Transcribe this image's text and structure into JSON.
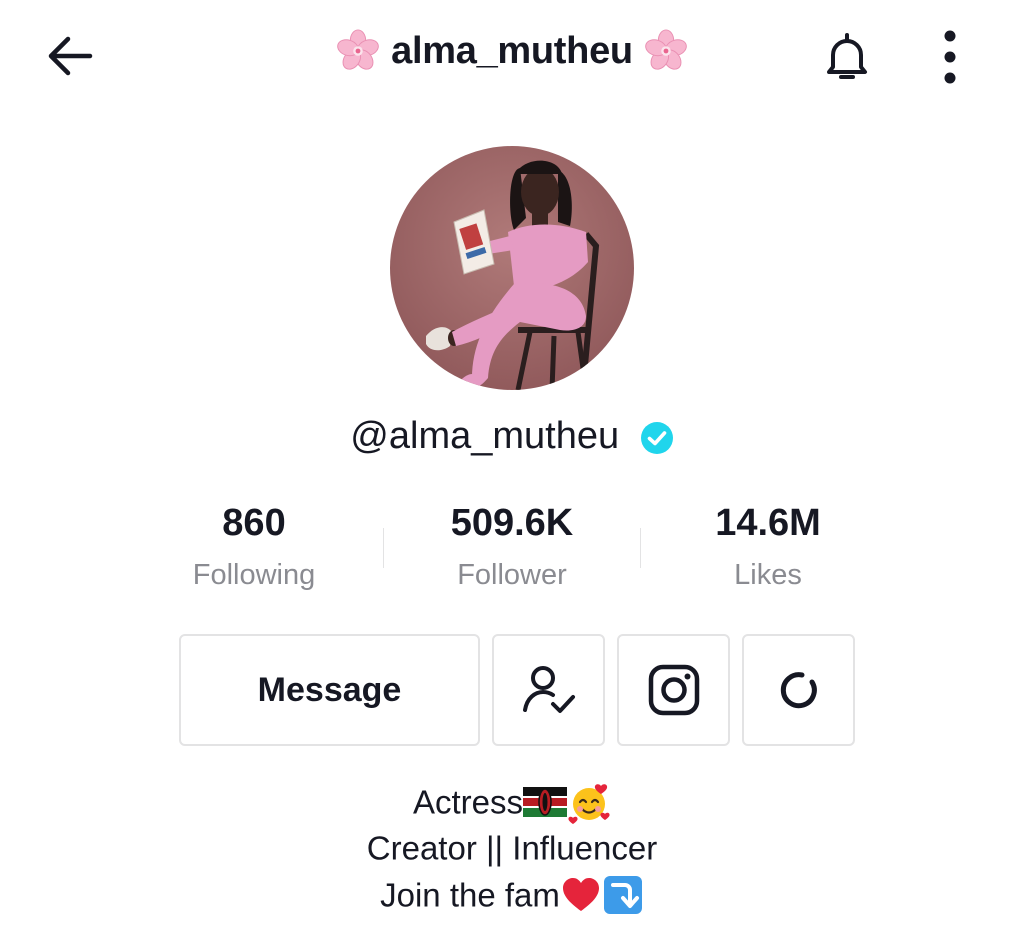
{
  "header": {
    "title": "alma_mutheu",
    "icons": {
      "back": "arrow-left-icon",
      "notifications": "bell-icon",
      "more": "more-vertical-icon",
      "title_decoration": "cherry-blossom-emoji"
    }
  },
  "profile": {
    "username": "@alma_mutheu",
    "verified": true,
    "accent_color": "#20d5ec"
  },
  "stats": [
    {
      "value": "860",
      "label": "Following"
    },
    {
      "value": "509.6K",
      "label": "Follower"
    },
    {
      "value": "14.6M",
      "label": "Likes"
    }
  ],
  "actions": {
    "message_label": "Message",
    "icons": {
      "friends": "user-check-icon",
      "instagram": "instagram-icon",
      "loading": "loading-spinner-icon"
    }
  },
  "bio": {
    "line1": "Actress",
    "line1_emojis": [
      "kenya-flag-emoji",
      "smiling-face-with-hearts-emoji"
    ],
    "line2": "Creator || Influencer",
    "line3": "Join the fam",
    "line3_emojis": [
      "red-heart-emoji",
      "arrow-down-curve-emoji"
    ]
  },
  "colors": {
    "text_primary": "#161823",
    "text_secondary": "#8a8b91",
    "border": "#e3e3e4"
  }
}
